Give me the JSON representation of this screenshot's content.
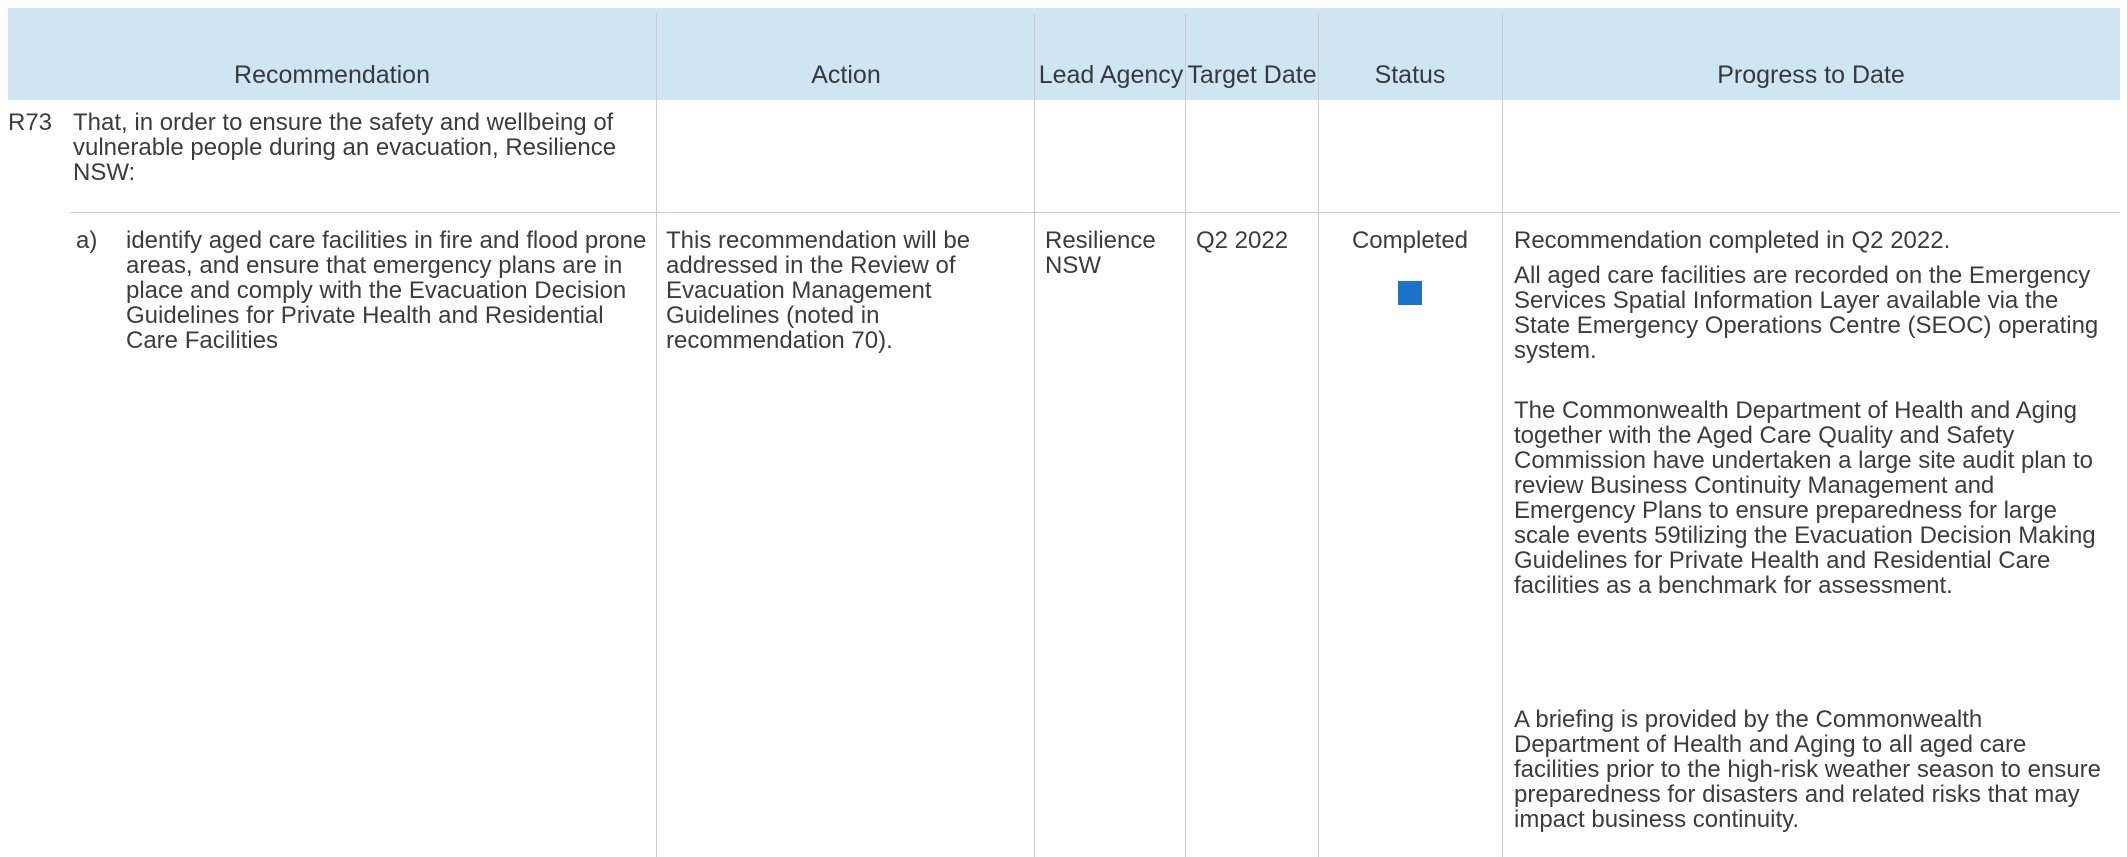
{
  "table": {
    "headers": {
      "recommendation": "Recommendation",
      "action": "Action",
      "lead_agency": "Lead Agency",
      "target_date": "Target Date",
      "status": "Status",
      "progress": "Progress to Date"
    },
    "section_row": {
      "id": "R73",
      "text": "That, in order to ensure the safety and wellbeing of vulnerable people during an evacuation, Resilience NSW:"
    },
    "item_row": {
      "label": "a)",
      "recommendation": "identify aged care facilities in fire and flood prone areas, and ensure that emergency plans are in place and comply with the Evacuation Decision Guidelines for Private Health and Residential Care Facilities",
      "action": "This recommendation will be addressed in the Review of Evacuation Management Guidelines (noted in recommendation 70).",
      "lead_agency": "Resilience NSW",
      "target_date": "Q2 2022",
      "status": "Completed",
      "status_color": "#1a73c9",
      "progress": [
        "Recommendation completed in Q2 2022.",
        "All aged care facilities are recorded on the Emergency Services Spatial Information Layer available via the State Emergency Operations Centre (SEOC) operating system.",
        "The Commonwealth Department of Health and Aging together with the Aged Care Quality and Safety Commission have undertaken a large site audit plan to review Business Continuity Management and Emergency Plans to ensure preparedness for large scale events 59tilizing the Evacuation Decision Making Guidelines for Private Health and Residential Care facilities as a benchmark for assessment.",
        "A briefing is provided by the Commonwealth Department of Health and Aging to all aged care facilities prior to the high-risk weather season to ensure preparedness for disasters and related risks that may impact business continuity."
      ]
    }
  }
}
